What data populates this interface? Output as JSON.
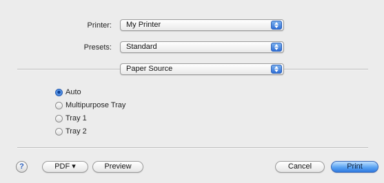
{
  "printer": {
    "label": "Printer:",
    "value": "My Printer"
  },
  "presets": {
    "label": "Presets:",
    "value": "Standard"
  },
  "pane": {
    "value": "Paper Source"
  },
  "paper_source": {
    "options": [
      {
        "label": "Auto",
        "selected": true
      },
      {
        "label": "Multipurpose Tray",
        "selected": false
      },
      {
        "label": "Tray 1",
        "selected": false
      },
      {
        "label": "Tray 2",
        "selected": false
      }
    ]
  },
  "buttons": {
    "help": "?",
    "pdf": "PDF ▾",
    "preview": "Preview",
    "cancel": "Cancel",
    "print": "Print"
  },
  "colors": {
    "accent": "#2f6fd6",
    "background": "#ececec"
  }
}
